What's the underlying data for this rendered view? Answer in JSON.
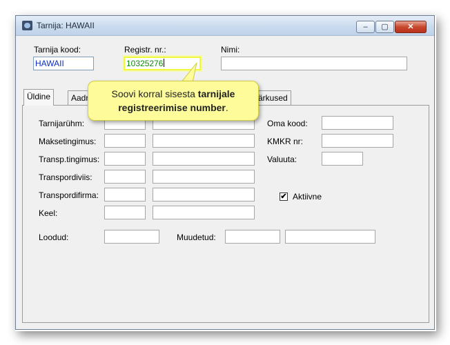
{
  "window": {
    "title": "Tarnija: HAWAII",
    "buttons": {
      "minimize": "–",
      "maximize": "▢",
      "close": "✕"
    }
  },
  "header": {
    "supplier_code_label": "Tarnija kood:",
    "supplier_code_value": "HAWAII",
    "reg_nr_label": "Registr. nr.:",
    "reg_nr_value": "10325276",
    "name_label": "Nimi:",
    "name_value": ""
  },
  "tabs": [
    {
      "label": "Üldine",
      "active": true
    },
    {
      "label": "Aadr"
    },
    {
      "label": "ärkused"
    }
  ],
  "form": {
    "supplier_group_label": "Tarnijarühm:",
    "payment_terms_label": "Maksetingimus:",
    "transport_terms_label": "Transp.tingimus:",
    "transport_mode_label": "Transpordiviis:",
    "transport_company_label": "Transpordifirma:",
    "language_label": "Keel:",
    "own_code_label": "Oma kood:",
    "vat_nr_label": "KMKR nr:",
    "currency_label": "Valuuta:",
    "active_label": "Aktiivne",
    "active_checked": true,
    "active_mark": "✔",
    "created_label": "Loodud:",
    "modified_label": "Muudetud:"
  },
  "callout": {
    "text_plain": "Soovi korral sisesta ",
    "text_bold_1": "tarnijale",
    "text_bold_2": "registreerimise number",
    "text_end": "."
  },
  "colors": {
    "callout_bg": "#fdfb9a",
    "focus_highlight": "#f0f83c",
    "code_text": "#0a2cc2",
    "reg_text": "#0a8a0a"
  }
}
